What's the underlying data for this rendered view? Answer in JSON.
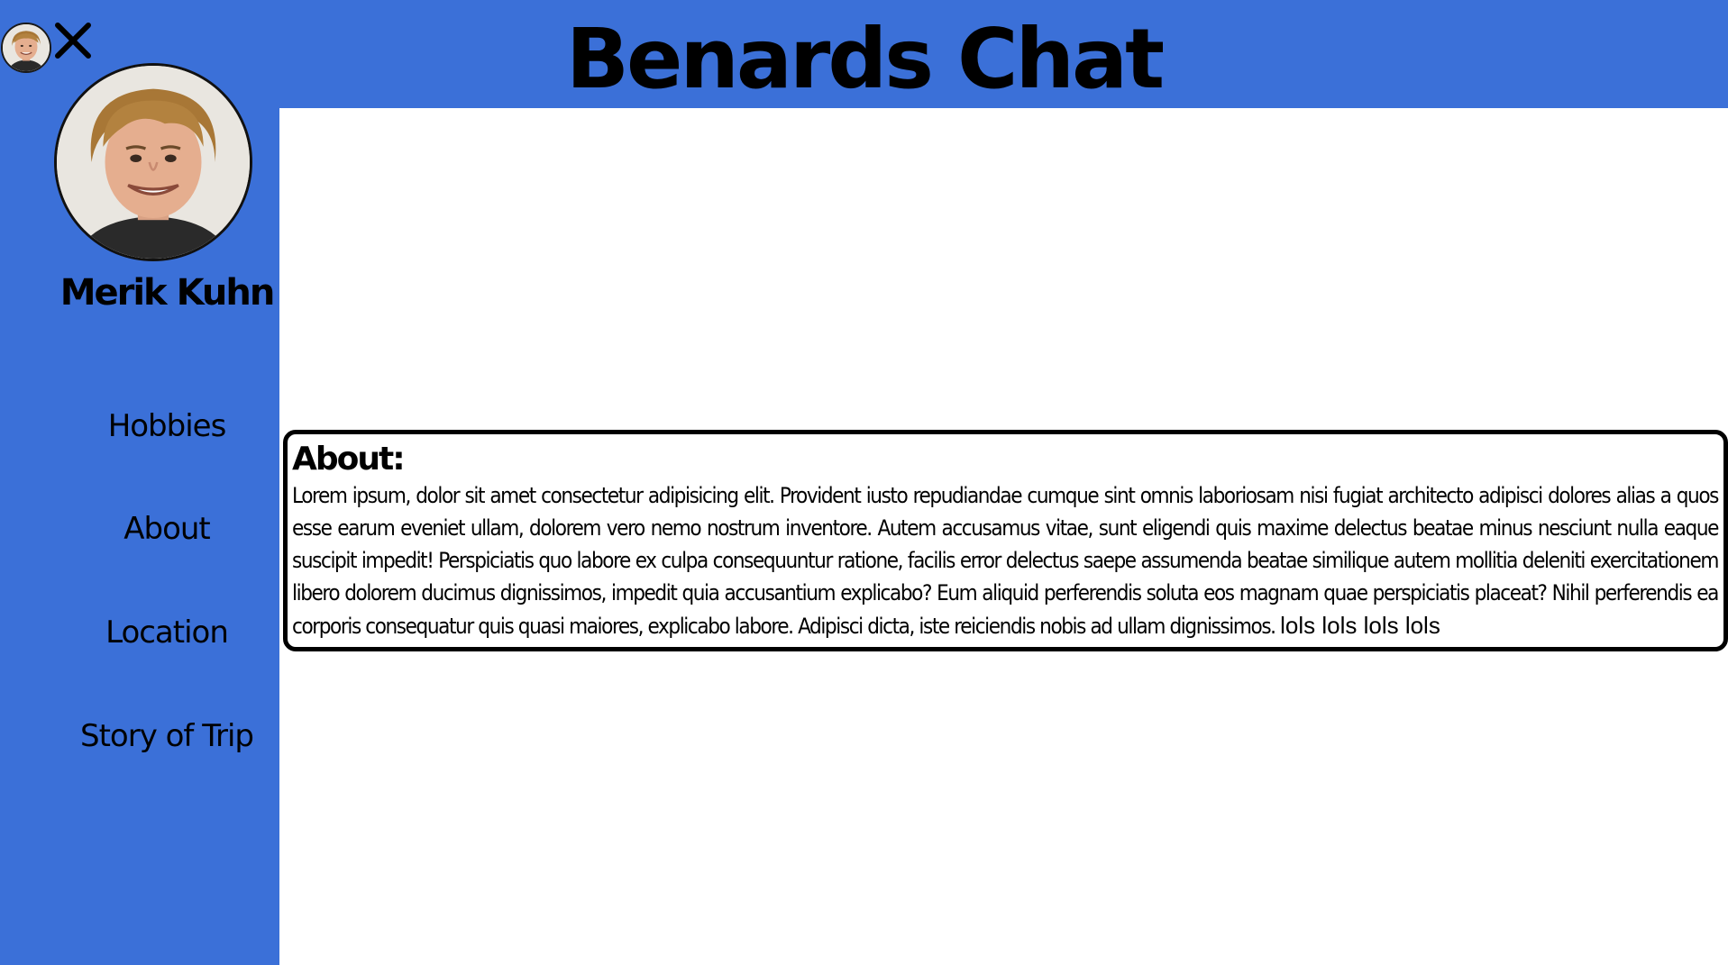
{
  "header": {
    "title": "Benards Chat"
  },
  "sidebar": {
    "user_name": "Merik Kuhn",
    "nav": [
      {
        "label": "Hobbies"
      },
      {
        "label": "About"
      },
      {
        "label": "Location"
      },
      {
        "label": "Story of Trip"
      }
    ],
    "close_icon": "close-icon",
    "background_color": "#3b70d8"
  },
  "about": {
    "heading": "About:",
    "body": "Lorem ipsum, dolor sit amet consectetur adipisicing elit. Provident iusto repudiandae cumque sint omnis laboriosam nisi fugiat architecto adipisci dolores alias a quos esse earum eveniet ullam, dolorem vero nemo nostrum inventore. Autem accusamus vitae, sunt eligendi quis maxime delectus beatae minus nesciunt nulla eaque suscipit impedit! Perspiciatis quo labore ex culpa consequuntur ratione, facilis error delectus saepe assumenda beatae similique autem mollitia deleniti exercitationem libero dolorem ducimus dignissimos, impedit quia accusantium explicabo? Eum aliquid perferendis soluta eos magnam quae perspiciatis placeat? Nihil perferendis ea corporis consequatur quis quasi maiores, explicabo labore. Adipisci dicta, iste reiciendis nobis ad ullam dignissimos.",
    "tail": "lols lols lols lols"
  }
}
